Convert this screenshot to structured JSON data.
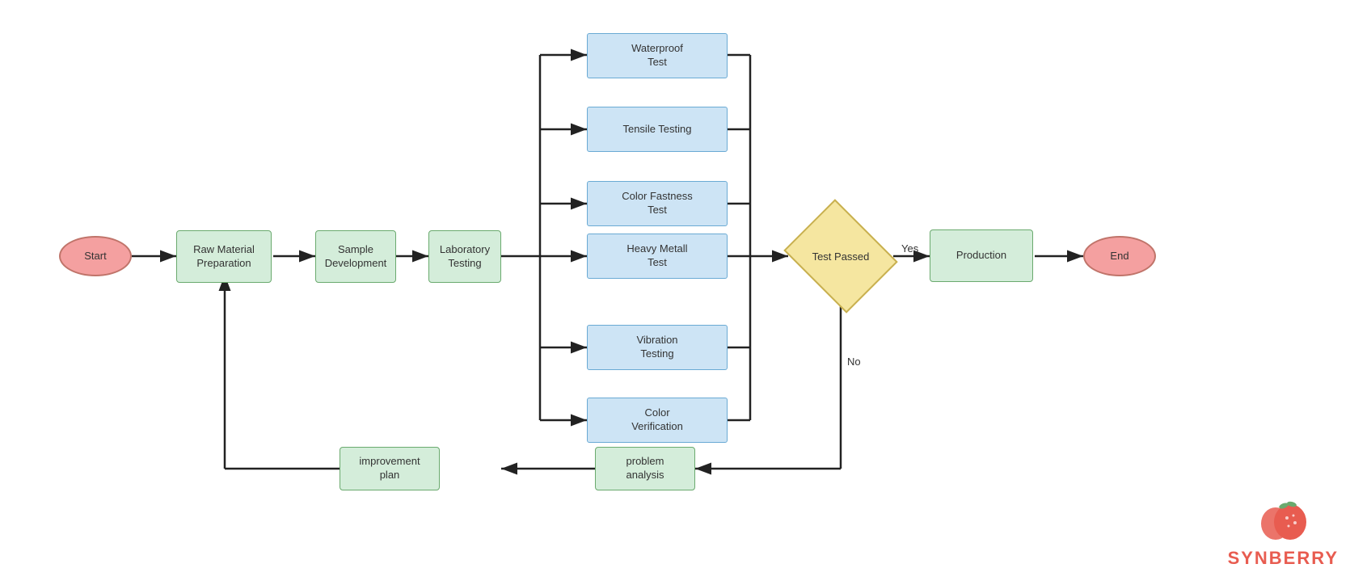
{
  "nodes": {
    "start": {
      "label": "Start"
    },
    "raw_material": {
      "label": "Raw Material\nPreparation"
    },
    "sample_dev": {
      "label": "Sample\nDevelopment"
    },
    "lab_testing": {
      "label": "Laboratory\nTesting"
    },
    "waterproof": {
      "label": "Waterproof\nTest"
    },
    "tensile": {
      "label": "Tensile Testing"
    },
    "color_fastness": {
      "label": "Color Fastness\nTest"
    },
    "heavy_metal": {
      "label": "Heavy Metall\nTest"
    },
    "vibration": {
      "label": "Vibration\nTesting"
    },
    "color_verif": {
      "label": "Color\nVerification"
    },
    "test_passed": {
      "label": "Test Passed"
    },
    "production": {
      "label": "Production"
    },
    "end": {
      "label": "End"
    },
    "problem_analysis": {
      "label": "problem\nanalysis"
    },
    "improvement_plan": {
      "label": "improvement\nplan"
    }
  },
  "labels": {
    "yes": "Yes",
    "no": "No"
  },
  "brand": {
    "name": "SYNBERRY",
    "color": "#e85c50"
  }
}
